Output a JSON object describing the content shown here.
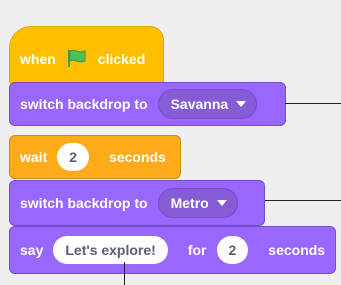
{
  "script": {
    "when_flag": {
      "label_before": "when",
      "flag_icon": "green-flag-icon",
      "label_after": "clicked"
    },
    "switch_backdrop_1": {
      "label": "switch backdrop to",
      "value": "Savanna"
    },
    "wait": {
      "label_before": "wait",
      "value": "2",
      "label_after": "seconds"
    },
    "switch_backdrop_2": {
      "label": "switch backdrop to",
      "value": "Metro"
    },
    "say_for": {
      "label_before": "say",
      "message": "Let's explore!",
      "label_mid": "for",
      "seconds": "2",
      "label_after": "seconds"
    }
  },
  "colors": {
    "events": "#ffbf00",
    "looks": "#9966ff",
    "control": "#ffab19",
    "flag": "#4cbf56"
  }
}
